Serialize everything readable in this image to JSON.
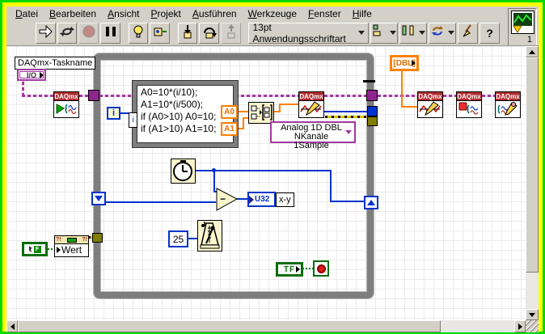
{
  "window": {
    "instance_count": "1"
  },
  "menu": {
    "items": [
      "Datei",
      "Bearbeiten",
      "Ansicht",
      "Projekt",
      "Ausführen",
      "Werkzeuge",
      "Fenster",
      "Hilfe"
    ]
  },
  "toolbar": {
    "font_selector": "13pt Anwendungsschriftart",
    "help_glyph": "?"
  },
  "diagram": {
    "task_name_label": "DAQmx-Taskname",
    "io_control": "I/O",
    "daqmx_header": "DAQmx",
    "formula_node": {
      "lines": [
        "A0=10*(i/10);",
        "A1=10*(i/500);",
        "if (A0>10) A0=10;",
        "if (A1>10) A1=10;"
      ],
      "border_input": "i",
      "outputs": [
        "A0",
        "A1"
      ]
    },
    "iteration_terminal": "i",
    "polymorphic_selector": {
      "line1": "Analog 1D DBL",
      "line2": "NKanäle 1Sample"
    },
    "subtract_sign": "−",
    "u32_indicator": "U32",
    "u32_label": "x-y",
    "wait_ms_constant": "25",
    "stop_button_terminal": "TF",
    "property_node": {
      "property": "Wert",
      "banner": "?!"
    },
    "bool_reference_letter": "F",
    "dbl_array_control": "[DBL]"
  },
  "colors": {
    "task_wire": "#a03aa0",
    "dbl_orange": "#ff8000",
    "int_blue": "#0033cc",
    "bool_green": "#0a6e0a",
    "error_yellow": "#d8c400",
    "loop_gray": "#7e7e7e",
    "daqmx_red": "#b22e31",
    "window_border": "#00d800"
  }
}
